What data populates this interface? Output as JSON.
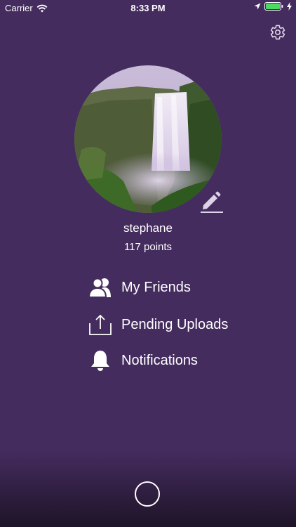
{
  "status_bar": {
    "carrier": "Carrier",
    "time": "8:33 PM"
  },
  "profile": {
    "username": "stephane",
    "points": "117 points"
  },
  "menu": [
    {
      "label": "My Friends",
      "icon": "friends-icon"
    },
    {
      "label": "Pending Uploads",
      "icon": "upload-icon"
    },
    {
      "label": "Notifications",
      "icon": "bell-icon"
    }
  ],
  "colors": {
    "background": "#452c5f",
    "text": "#ffffff",
    "battery": "#4cd964"
  }
}
